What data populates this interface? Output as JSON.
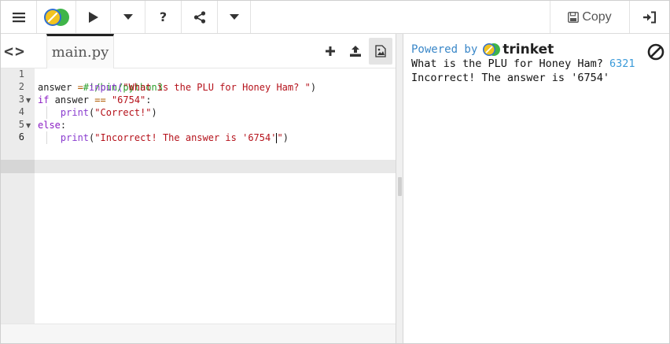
{
  "toolbar": {
    "menu_icon": "hamburger-menu-icon",
    "logo_icon": "trinket-logo-icon",
    "run_icon": "play-icon",
    "run_options_icon": "caret-down-icon",
    "help_label": "?",
    "share_icon": "share-icon",
    "share_options_icon": "caret-down-icon",
    "copy_label": "Copy",
    "copy_icon": "floppy-disk-icon",
    "signin_icon": "sign-in-icon"
  },
  "editor": {
    "nav_label": "<>",
    "file_tab": "main.py",
    "tools": [
      "plus-icon",
      "upload-icon",
      "image-file-icon"
    ],
    "line_numbers": [
      "1",
      "2",
      "3",
      "4",
      "5",
      "6"
    ],
    "lines": {
      "l1": "#!/bin/python3",
      "l2_a": "answer ",
      "l2_op": "=",
      "l2_b": " input(",
      "l2_str": "\"What is the PLU for Honey Ham? \"",
      "l2_c": ")",
      "l3_kw": "if",
      "l3_a": " answer ",
      "l3_op": "==",
      "l3_sp": " ",
      "l3_str": "\"6754\"",
      "l3_c": ":",
      "l4_fn": "print",
      "l4_a": "(",
      "l4_str": "\"Correct!\"",
      "l4_c": ")",
      "l5_kw": "else",
      "l5_c": ":",
      "l6_fn": "print",
      "l6_a": "(",
      "l6_str": "\"Incorrect! The answer is '6754'",
      "l6_str_end": "\"",
      "l6_c": ")"
    }
  },
  "output": {
    "powered_by": "Powered by",
    "brand": "trinket",
    "stop_icon": "stop-circle-icon",
    "line1_prompt": "What is the PLU for Honey Ham? ",
    "line1_input": "6321",
    "line2": "Incorrect! The answer is '6754'"
  },
  "colors": {
    "accent_blue": "#3a87c8",
    "logo_yellow": "#f2c320",
    "logo_green": "#3fb549",
    "logo_blue": "#2e6fd1"
  }
}
